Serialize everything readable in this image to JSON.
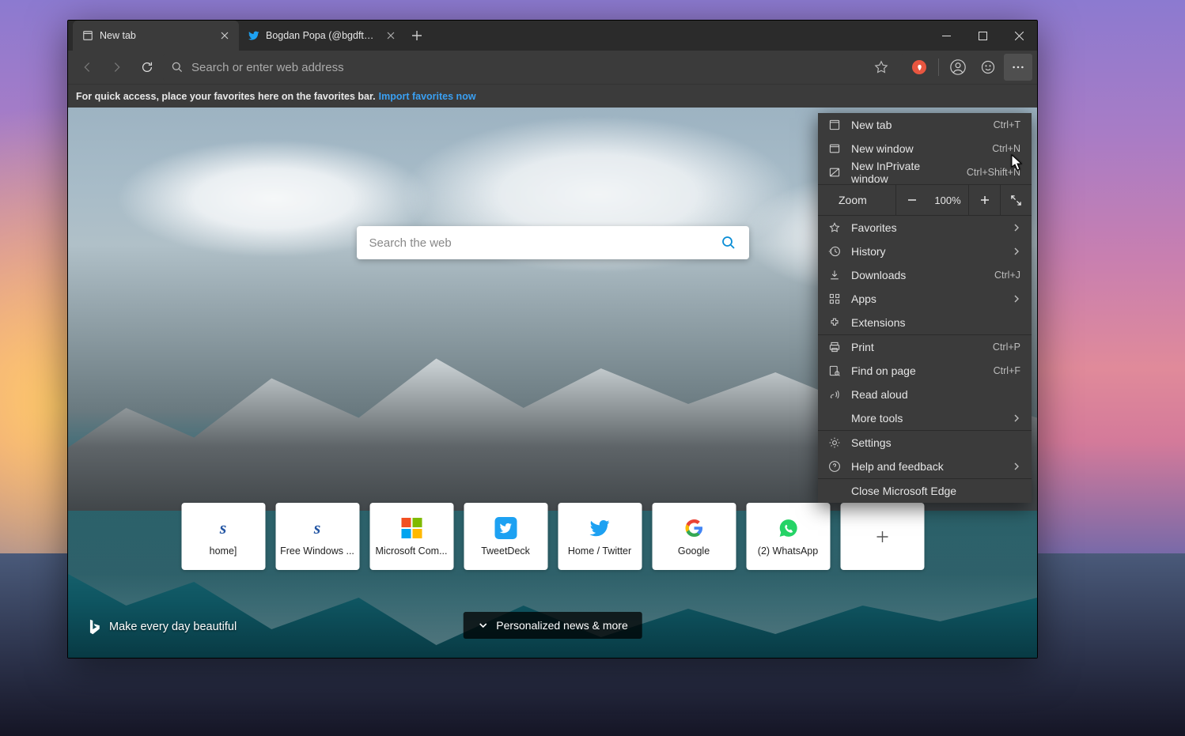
{
  "tabs": [
    {
      "label": "New tab",
      "icon": "page"
    },
    {
      "label": "Bogdan Popa (@bgdftw) / Twitter",
      "icon": "twitter"
    }
  ],
  "addr": {
    "placeholder": "Search or enter web address"
  },
  "favbar": {
    "text": "For quick access, place your favorites here on the favorites bar.",
    "link": "Import favorites now"
  },
  "ntp": {
    "search_placeholder": "Search the web",
    "bing_tagline": "Make every day beautiful",
    "news_button": "Personalized news & more",
    "tiles": [
      {
        "label": "home]",
        "icon": "s"
      },
      {
        "label": "Free Windows ...",
        "icon": "s"
      },
      {
        "label": "Microsoft Com...",
        "icon": "ms"
      },
      {
        "label": "TweetDeck",
        "icon": "tw"
      },
      {
        "label": "Home / Twitter",
        "icon": "twbird"
      },
      {
        "label": "Google",
        "icon": "g"
      },
      {
        "label": "(2) WhatsApp",
        "icon": "wa"
      },
      {
        "label": "",
        "icon": "plus"
      }
    ]
  },
  "menu": {
    "zoom_label": "Zoom",
    "zoom_value": "100%",
    "items1": [
      {
        "label": "New tab",
        "accel": "Ctrl+T",
        "icon": "page"
      },
      {
        "label": "New window",
        "accel": "Ctrl+N",
        "icon": "window"
      },
      {
        "label": "New InPrivate window",
        "accel": "Ctrl+Shift+N",
        "icon": "inprivate"
      }
    ],
    "items2": [
      {
        "label": "Favorites",
        "icon": "star",
        "arrow": true
      },
      {
        "label": "History",
        "icon": "history",
        "arrow": true
      },
      {
        "label": "Downloads",
        "icon": "download",
        "accel": "Ctrl+J"
      },
      {
        "label": "Apps",
        "icon": "apps",
        "arrow": true
      },
      {
        "label": "Extensions",
        "icon": "ext"
      }
    ],
    "items3": [
      {
        "label": "Print",
        "icon": "print",
        "accel": "Ctrl+P"
      },
      {
        "label": "Find on page",
        "icon": "find",
        "accel": "Ctrl+F"
      },
      {
        "label": "Read aloud",
        "icon": "read"
      },
      {
        "label": "More tools",
        "arrow": true
      }
    ],
    "items4": [
      {
        "label": "Settings",
        "icon": "gear"
      },
      {
        "label": "Help and feedback",
        "icon": "help",
        "arrow": true
      }
    ],
    "items5": [
      {
        "label": "Close Microsoft Edge"
      }
    ]
  }
}
